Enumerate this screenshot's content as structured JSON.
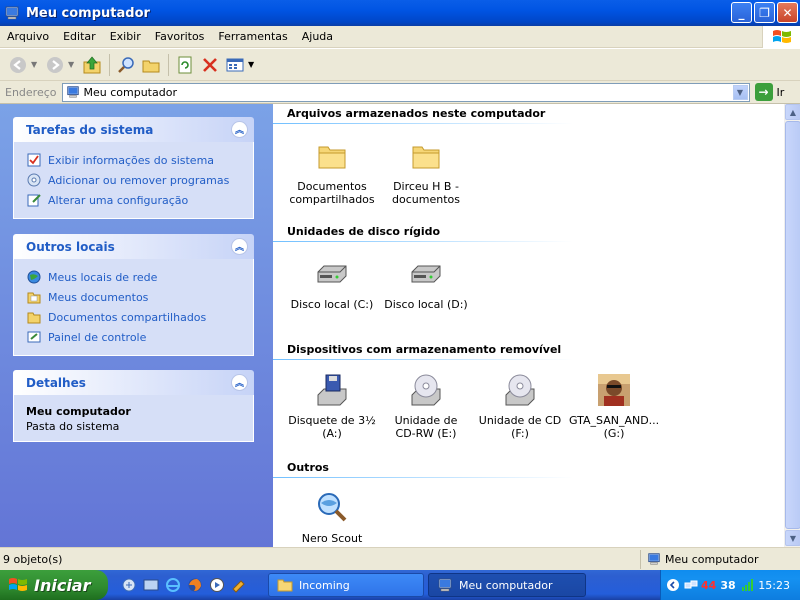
{
  "window": {
    "title": "Meu computador",
    "buttons": {
      "minimize": "_",
      "maximize": "❐",
      "close": "✕"
    }
  },
  "menu": [
    "Arquivo",
    "Editar",
    "Exibir",
    "Favoritos",
    "Ferramentas",
    "Ajuda"
  ],
  "address": {
    "label": "Endereço",
    "value": "Meu computador",
    "go_label": "Ir"
  },
  "taskpane": {
    "system_tasks": {
      "title": "Tarefas do sistema",
      "items": [
        "Exibir informações do sistema",
        "Adicionar ou remover programas",
        "Alterar uma configuração"
      ]
    },
    "other_places": {
      "title": "Outros locais",
      "items": [
        "Meus locais de rede",
        "Meus documentos",
        "Documentos compartilhados",
        "Painel de controle"
      ]
    },
    "details": {
      "title": "Detalhes",
      "name": "Meu computador",
      "description": "Pasta do sistema"
    }
  },
  "groups": {
    "stored_files": {
      "title": "Arquivos armazenados neste computador",
      "items": [
        {
          "line1": "Documentos",
          "line2": "compartilhados",
          "icon": "folder-icon"
        },
        {
          "line1": "Dirceu H B -",
          "line2": "documentos",
          "icon": "folder-icon"
        }
      ]
    },
    "hard_disks": {
      "title": "Unidades de disco rígido",
      "items": [
        {
          "line1": "Disco local (C:)",
          "icon": "hard-disk-icon"
        },
        {
          "line1": "Disco local (D:)",
          "icon": "hard-disk-icon"
        }
      ]
    },
    "removable": {
      "title": "Dispositivos com armazenamento removível",
      "items": [
        {
          "line1": "Disquete de 3½",
          "line2": "(A:)",
          "icon": "floppy-icon"
        },
        {
          "line1": "Unidade de",
          "line2": "CD-RW (E:)",
          "icon": "cd-drive-icon"
        },
        {
          "line1": "Unidade de CD",
          "line2": "(F:)",
          "icon": "cd-drive-icon"
        },
        {
          "line1": "GTA_SAN_AND...",
          "line2": "(G:)",
          "icon": "game-disc-icon"
        }
      ]
    },
    "others": {
      "title": "Outros",
      "items": [
        {
          "line1": "Nero Scout",
          "icon": "nero-scout-icon"
        }
      ]
    }
  },
  "status": {
    "left": "9 objeto(s)",
    "right": "Meu computador"
  },
  "taskbar": {
    "start": "Iniciar",
    "tasks": [
      "Incoming",
      "Meu computador"
    ],
    "tray": {
      "text_a": "44",
      "text_b": "38",
      "clock": "15:23"
    }
  }
}
